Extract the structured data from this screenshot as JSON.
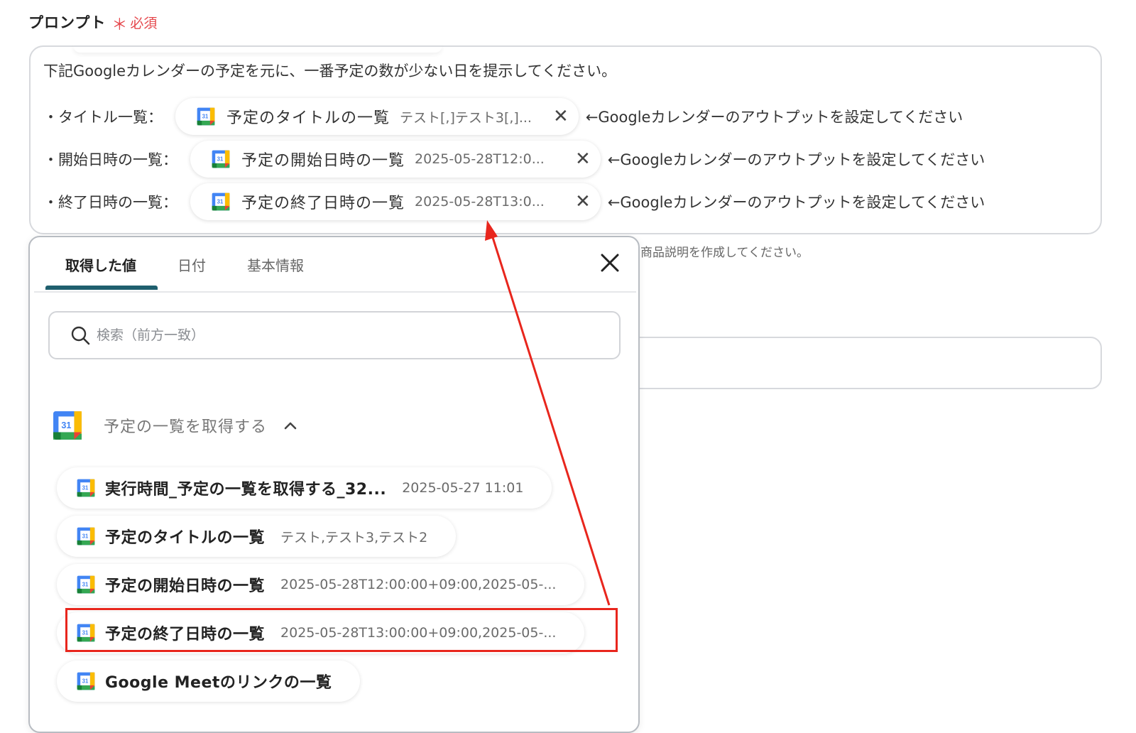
{
  "field": {
    "label": "プロンプト",
    "required_star": "＊",
    "required_text": "必須"
  },
  "prompt": {
    "first_line": "下記Googleカレンダーの予定を元に、一番予定の数が少ない日を提示してください。",
    "rows": [
      {
        "label": "・タイトル一覧：",
        "chip_name": "予定のタイトルの一覧",
        "chip_value": "テスト[,]テスト3[,]...",
        "hint": "←Googleカレンダーのアウトプットを設定してください"
      },
      {
        "label": "・開始日時の一覧：",
        "chip_name": "予定の開始日時の一覧",
        "chip_value": "2025-05-28T12:0...",
        "hint": "←Googleカレンダーのアウトプットを設定してください"
      },
      {
        "label": "・終了日時の一覧：",
        "chip_name": "予定の終了日時の一覧",
        "chip_value": "2025-05-28T13:0...",
        "hint": "←Googleカレンダーのアウトプットを設定してください"
      }
    ]
  },
  "background_note": "商品説明を作成してください。",
  "panel": {
    "tabs": [
      "取得した値",
      "日付",
      "基本情報"
    ],
    "active_tab": "取得した値",
    "search_placeholder": "検索（前方一致）",
    "group_title": "予定の一覧を取得する",
    "calendar_icon_text": "31",
    "items": [
      {
        "name": "実行時間_予定の一覧を取得する_32...",
        "value": "2025-05-27 11:01"
      },
      {
        "name": "予定のタイトルの一覧",
        "value": "テスト,テスト3,テスト2"
      },
      {
        "name": "予定の開始日時の一覧",
        "value": "2025-05-28T12:00:00+09:00,2025-05-..."
      },
      {
        "name": "予定の終了日時の一覧",
        "value": "2025-05-28T13:00:00+09:00,2025-05-..."
      },
      {
        "name": "Google Meetのリンクの一覧",
        "value": ""
      }
    ]
  },
  "colors": {
    "required": "#e5484d",
    "tab_underline": "#1f5f6e",
    "annotation_red": "#e8261d",
    "border": "#d7d9dd"
  }
}
